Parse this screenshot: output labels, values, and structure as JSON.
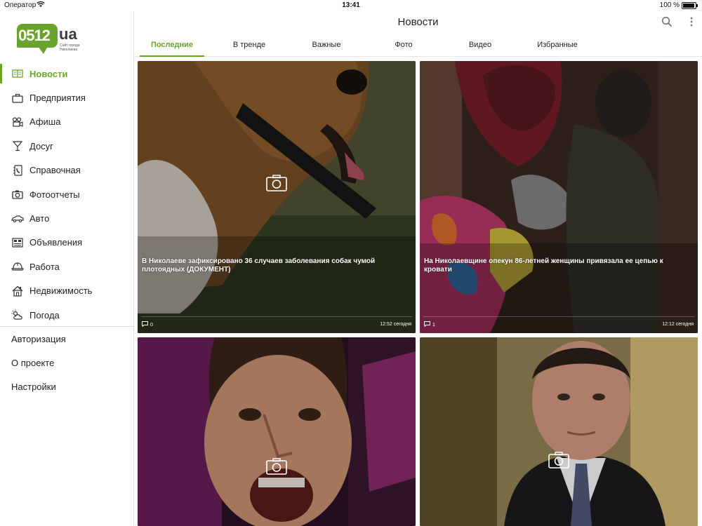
{
  "status_bar": {
    "carrier": "Оператор",
    "time": "13:41",
    "battery": "100 %"
  },
  "logo": {
    "number": "0512",
    "suffix": "ua",
    "tagline_1": "Сайт города",
    "tagline_2": "Николаева"
  },
  "sidebar": {
    "items": [
      {
        "label": "Новости",
        "icon": "newspaper-icon",
        "active": true
      },
      {
        "label": "Предприятия",
        "icon": "briefcase-icon"
      },
      {
        "label": "Афиша",
        "icon": "film-camera-icon"
      },
      {
        "label": "Досуг",
        "icon": "cocktail-icon"
      },
      {
        "label": "Справочная",
        "icon": "phone-book-icon"
      },
      {
        "label": "Фотоотчеты",
        "icon": "camera-icon"
      },
      {
        "label": "Авто",
        "icon": "car-icon"
      },
      {
        "label": "Объявления",
        "icon": "ads-board-icon"
      },
      {
        "label": "Работа",
        "icon": "hard-hat-icon"
      },
      {
        "label": "Недвижимость",
        "icon": "house-icon"
      },
      {
        "label": "Погода",
        "icon": "weather-icon"
      }
    ],
    "extra": [
      {
        "label": "Авторизация"
      },
      {
        "label": "О проекте"
      },
      {
        "label": "Настройки"
      }
    ]
  },
  "header": {
    "title": "Новости",
    "search_icon": "search-icon",
    "more_icon": "more-vertical-icon"
  },
  "tabs": [
    {
      "label": "Последние",
      "active": true
    },
    {
      "label": "В тренде"
    },
    {
      "label": "Важные"
    },
    {
      "label": "Фото"
    },
    {
      "label": "Видео"
    },
    {
      "label": "Избранные"
    }
  ],
  "articles": [
    {
      "headline": "В Николаеве зафиксировано 36 случаев заболевания собак чумой плотоядных (ДОКУМЕНТ)",
      "comments": "0",
      "time": "12:52 сегодня",
      "image": "dog-photo"
    },
    {
      "headline": "На Николаевщине опекун 86-летней женщины привязала ее цепью к кровати",
      "comments": "1",
      "time": "12:12 сегодня",
      "image": "elderly-woman-photo"
    },
    {
      "headline": "",
      "comments": "",
      "time": "",
      "image": "boy-singing-photo"
    },
    {
      "headline": "",
      "comments": "",
      "time": "",
      "image": "man-portrait-photo"
    }
  ],
  "colors": {
    "accent": "#6aa329"
  }
}
